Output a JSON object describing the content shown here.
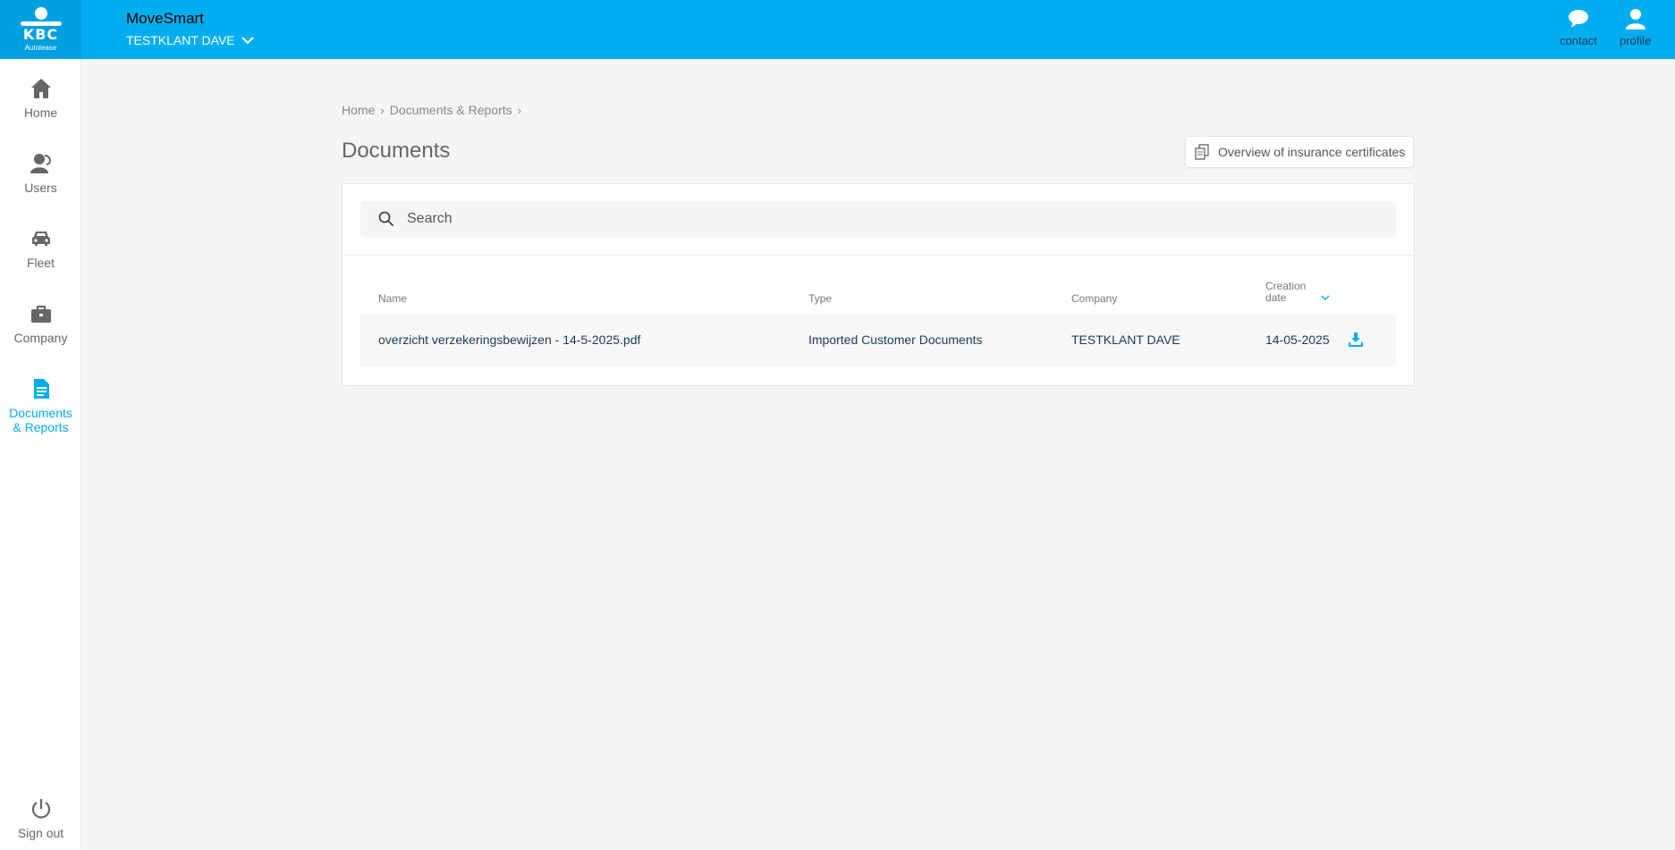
{
  "header": {
    "logo_text": "KBC",
    "logo_subtitle": "Autolease",
    "app_title": "MoveSmart",
    "client_name": "TESTKLANT DAVE",
    "contact_label": "contact",
    "profile_label": "profile"
  },
  "sidebar": {
    "items": [
      {
        "label": "Home",
        "icon": "home-icon"
      },
      {
        "label": "Users",
        "icon": "users-icon"
      },
      {
        "label": "Fleet",
        "icon": "car-icon"
      },
      {
        "label": "Company",
        "icon": "briefcase-icon"
      },
      {
        "label_line1": "Documents",
        "label_line2": "& Reports",
        "icon": "document-icon",
        "active": true
      }
    ],
    "sign_out_label": "Sign out"
  },
  "breadcrumb": [
    "Home",
    "Documents & Reports"
  ],
  "page_title": "Documents",
  "cert_button_label": "Overview of insurance certificates",
  "search": {
    "placeholder": "Search",
    "value": ""
  },
  "table": {
    "headers": {
      "name": "Name",
      "type": "Type",
      "company": "Company",
      "date_line1": "Creation",
      "date_line2": "date"
    },
    "rows": [
      {
        "name": "overzicht verzekeringsbewijzen - 14-5-2025.pdf",
        "type": "Imported Customer Documents",
        "company": "TESTKLANT DAVE",
        "date": "14-05-2025"
      }
    ]
  },
  "colors": {
    "primary": "#00aeef",
    "text_dark": "#1a3a5c",
    "background": "#f5f5f5"
  }
}
